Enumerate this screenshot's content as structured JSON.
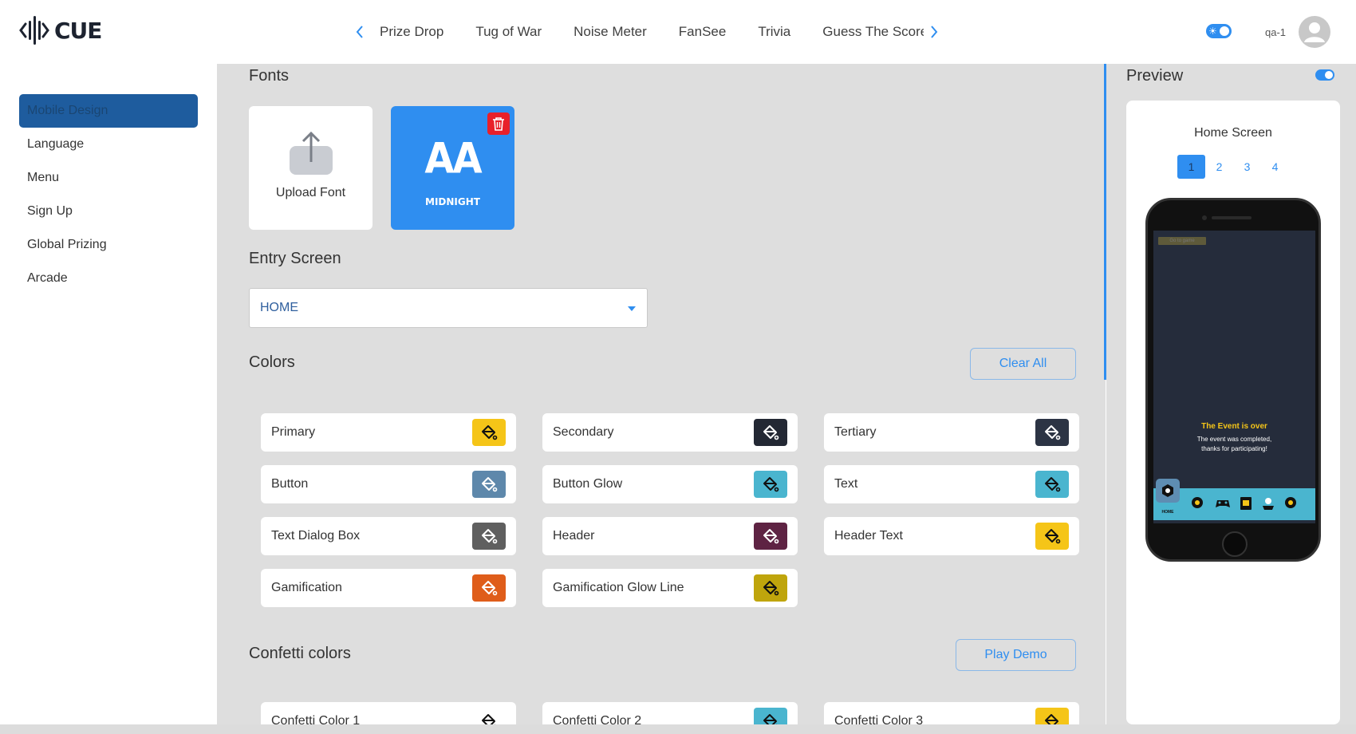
{
  "app": {
    "logo_text": "CUE"
  },
  "header": {
    "tabs": [
      "Prize Drop",
      "Tug of War",
      "Noise Meter",
      "FanSee",
      "Trivia",
      "Guess The Score"
    ],
    "user_name": "qa-1",
    "accent": "#2f8ef0"
  },
  "sidebar": {
    "items": [
      {
        "label": "Mobile Design",
        "active": true
      },
      {
        "label": "Language"
      },
      {
        "label": "Menu"
      },
      {
        "label": "Sign Up"
      },
      {
        "label": "Global Prizing"
      },
      {
        "label": "Arcade"
      }
    ]
  },
  "fonts": {
    "title": "Fonts",
    "upload_label": "Upload Font",
    "selected_font": {
      "glyph": "AA",
      "name": "MIDNIGHT"
    }
  },
  "entry_screen": {
    "title": "Entry Screen",
    "value": "HOME"
  },
  "colors": {
    "title": "Colors",
    "clear_label": "Clear All",
    "items": [
      {
        "label": "Primary",
        "color": "#f5c518",
        "icon_color": "#111"
      },
      {
        "label": "Secondary",
        "color": "#232834",
        "icon_color": "#fff"
      },
      {
        "label": "Tertiary",
        "color": "#2c3444",
        "icon_color": "#fff"
      },
      {
        "label": "Button",
        "color": "#5e88ab",
        "icon_color": "#fff"
      },
      {
        "label": "Button Glow",
        "color": "#4ab5cf",
        "icon_color": "#111"
      },
      {
        "label": "Text",
        "color": "#4ab5cf",
        "icon_color": "#111"
      },
      {
        "label": "Text Dialog Box",
        "color": "#5f5f5f",
        "icon_color": "#fff"
      },
      {
        "label": "Header",
        "color": "#5e2343",
        "icon_color": "#fff"
      },
      {
        "label": "Header Text",
        "color": "#f5c518",
        "icon_color": "#111"
      },
      {
        "label": "Gamification",
        "color": "#df5d1a",
        "icon_color": "#fff"
      },
      {
        "label": "Gamification Glow Line",
        "color": "#bfa50c",
        "icon_color": "#111"
      }
    ]
  },
  "confetti": {
    "title": "Confetti colors",
    "demo_label": "Play Demo",
    "items": [
      {
        "label": "Confetti Color 1",
        "color": "#ffffff",
        "icon_color": "#111"
      },
      {
        "label": "Confetti Color 2",
        "color": "#4ab5cf",
        "icon_color": "#111"
      },
      {
        "label": "Confetti Color 3",
        "color": "#f5c518",
        "icon_color": "#111"
      }
    ]
  },
  "preview": {
    "title": "Preview",
    "screen_name": "Home Screen",
    "pages": [
      "1",
      "2",
      "3",
      "4"
    ],
    "active_page": "1",
    "phone": {
      "go_to_game": "Go to game",
      "event_title": "The Event is over",
      "event_message_1": "The event was completed,",
      "event_message_2": "thanks for participating!",
      "nav_home_label": "HOME"
    }
  }
}
